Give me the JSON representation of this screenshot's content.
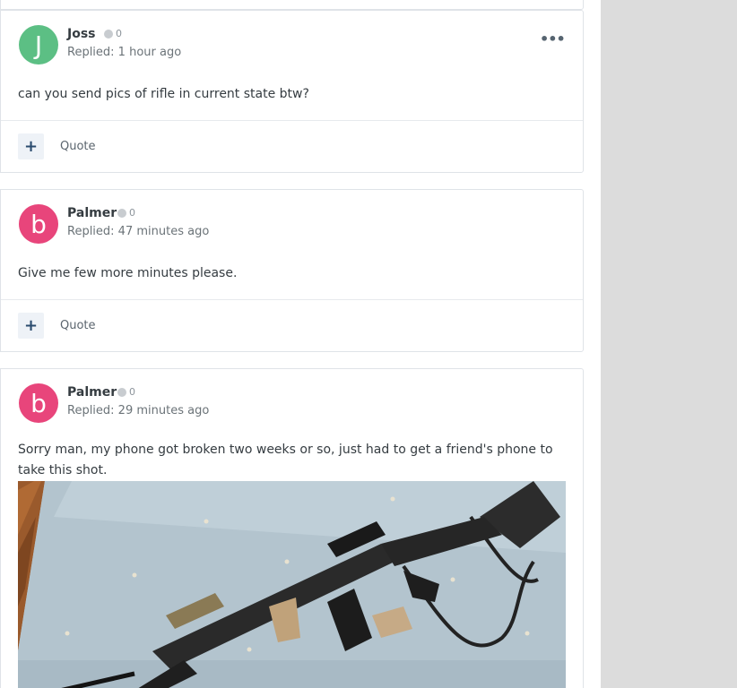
{
  "posts": [
    {
      "author": "Joss",
      "avatar_letter": "J",
      "avatar_color": "#5cbf84",
      "reputation": "0",
      "replied": "Replied: 1 hour ago",
      "body": "can you send pics of rifle in current state btw?",
      "quote_label": "Quote",
      "plus_label": "+",
      "menu_label": "•••"
    },
    {
      "author": "Palmer",
      "avatar_letter": "b",
      "avatar_color": "#e8457b",
      "reputation": "0",
      "replied": "Replied: 47 minutes ago",
      "body": "Give me few more minutes please.",
      "quote_label": "Quote",
      "plus_label": "+"
    },
    {
      "author": "Palmer",
      "avatar_letter": "b",
      "avatar_color": "#e8457b",
      "reputation": "0",
      "replied": "Replied: 29 minutes ago",
      "body": "Sorry man, my phone got broken two weeks or so, just had to get  a friend's phone to take this shot."
    }
  ],
  "colors": {
    "accent": "#2a4b6e",
    "muted_text": "#6b7378",
    "sidebar_bg": "#dcdcdc"
  }
}
